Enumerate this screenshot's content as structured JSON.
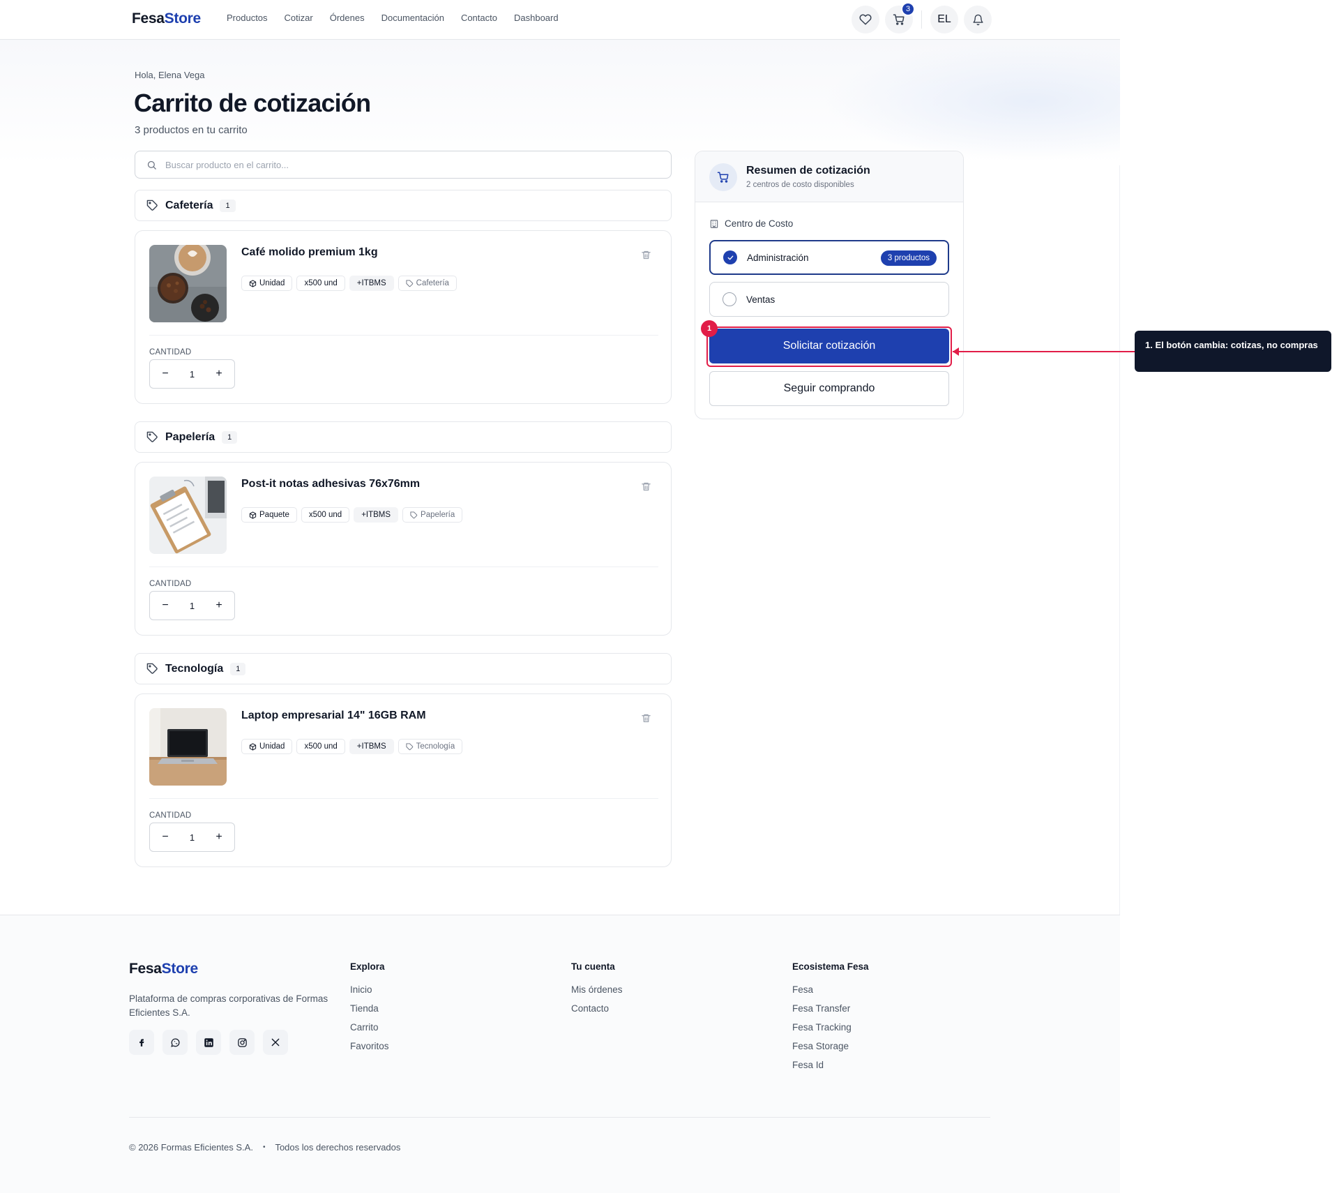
{
  "header": {
    "logo_part1": "Fesa",
    "logo_part2": "Store",
    "nav": [
      "Productos",
      "Cotizar",
      "Órdenes",
      "Documentación",
      "Contacto",
      "Dashboard"
    ],
    "cart_count": "3",
    "avatar_initials": "EL"
  },
  "page": {
    "greeting": "Hola, Elena Vega",
    "title": "Carrito de cotización",
    "subtitle": "3 productos en tu carrito",
    "search_placeholder": "Buscar producto en el carrito..."
  },
  "categories": [
    {
      "name": "Cafetería",
      "count": "1",
      "product": {
        "name": "Café molido premium 1kg",
        "tags": [
          "Unidad",
          "x500 und",
          "+ITBMS",
          "Cafetería"
        ],
        "qty_label": "CANTIDAD",
        "qty": "1"
      }
    },
    {
      "name": "Papelería",
      "count": "1",
      "product": {
        "name": "Post-it notas adhesivas 76x76mm",
        "tags": [
          "Paquete",
          "x500 und",
          "+ITBMS",
          "Papelería"
        ],
        "qty_label": "CANTIDAD",
        "qty": "1"
      }
    },
    {
      "name": "Tecnología",
      "count": "1",
      "product": {
        "name": "Laptop empresarial 14\" 16GB RAM",
        "tags": [
          "Unidad",
          "x500 und",
          "+ITBMS",
          "Tecnología"
        ],
        "qty_label": "CANTIDAD",
        "qty": "1"
      }
    }
  ],
  "summary": {
    "title": "Resumen de cotización",
    "subtitle": "2 centros de costo disponibles",
    "cost_center_label": "Centro de Costo",
    "options": [
      {
        "name": "Administración",
        "badge": "3 productos",
        "selected": true
      },
      {
        "name": "Ventas",
        "selected": false
      }
    ],
    "marker": "1",
    "primary_button": "Solicitar cotización",
    "secondary_button": "Seguir comprando"
  },
  "callout": {
    "text": "1. El botón cambia: cotizas, no compras"
  },
  "footer": {
    "logo_part1": "Fesa",
    "logo_part2": "Store",
    "description": "Plataforma de compras corporativas de Formas Eficientes S.A.",
    "socials": [
      "facebook-icon",
      "whatsapp-icon",
      "linkedin-icon",
      "instagram-icon",
      "x-icon"
    ],
    "columns": [
      {
        "title": "Explora",
        "links": [
          "Inicio",
          "Tienda",
          "Carrito",
          "Favoritos"
        ]
      },
      {
        "title": "Tu cuenta",
        "links": [
          "Mis órdenes",
          "Contacto"
        ]
      },
      {
        "title": "Ecosistema Fesa",
        "links": [
          "Fesa",
          "Fesa Transfer",
          "Fesa Tracking",
          "Fesa Storage",
          "Fesa Id"
        ]
      }
    ],
    "copyright": "© 2026 Formas Eficientes S.A.",
    "rights": "Todos los derechos reservados"
  },
  "colors": {
    "brand": "#1e40af",
    "accent_alert": "#e11d48",
    "callout_bg": "#0f172a"
  }
}
